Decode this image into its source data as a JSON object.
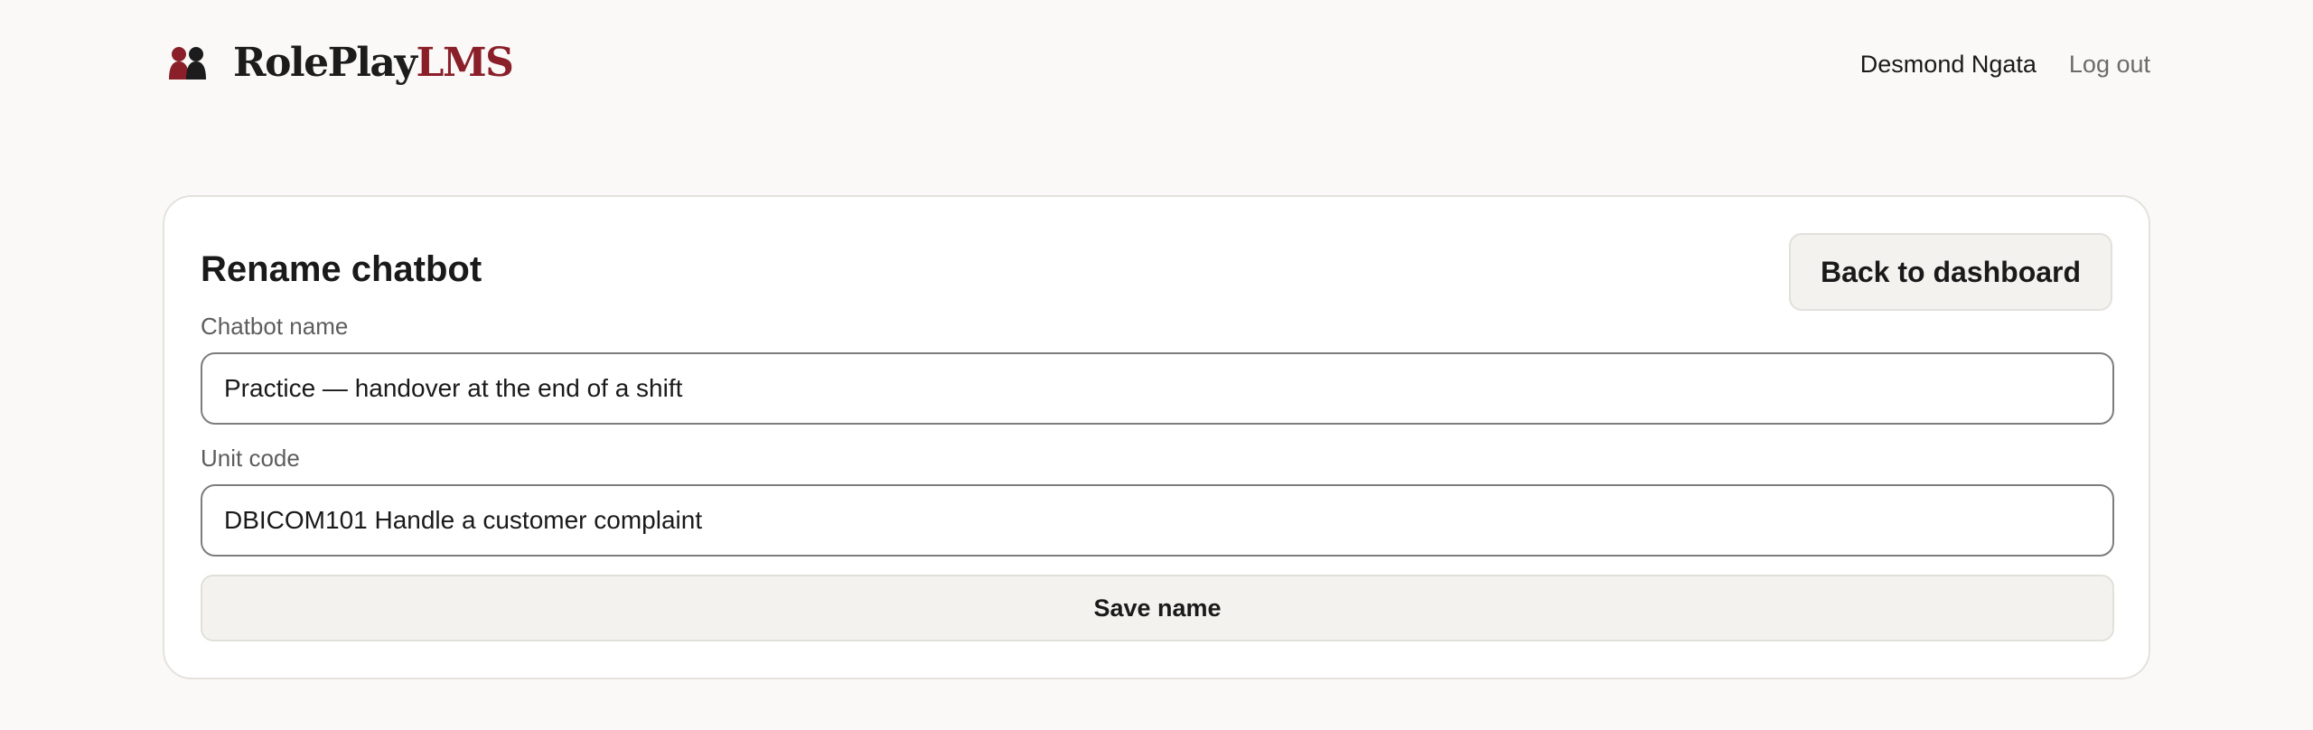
{
  "header": {
    "logo": {
      "icon": "two-people-silhouette-icon",
      "text_role": "RolePlay",
      "text_lms": "LMS"
    },
    "user_name": "Desmond Ngata",
    "logout_label": "Log out"
  },
  "card": {
    "title": "Rename chatbot",
    "back_label": "Back to dashboard",
    "fields": {
      "name_label": "Chatbot name",
      "name_value": "Practice — handover at the end of a shift",
      "unit_label": "Unit code",
      "unit_value": "DBICOM101 Handle a customer complaint"
    },
    "save_label": "Save name"
  },
  "colors": {
    "brand_dark": "#1c1c1c",
    "brand_red": "#8a1f2a",
    "background": "#faf9f7",
    "button_bg": "#f3f2ee"
  }
}
